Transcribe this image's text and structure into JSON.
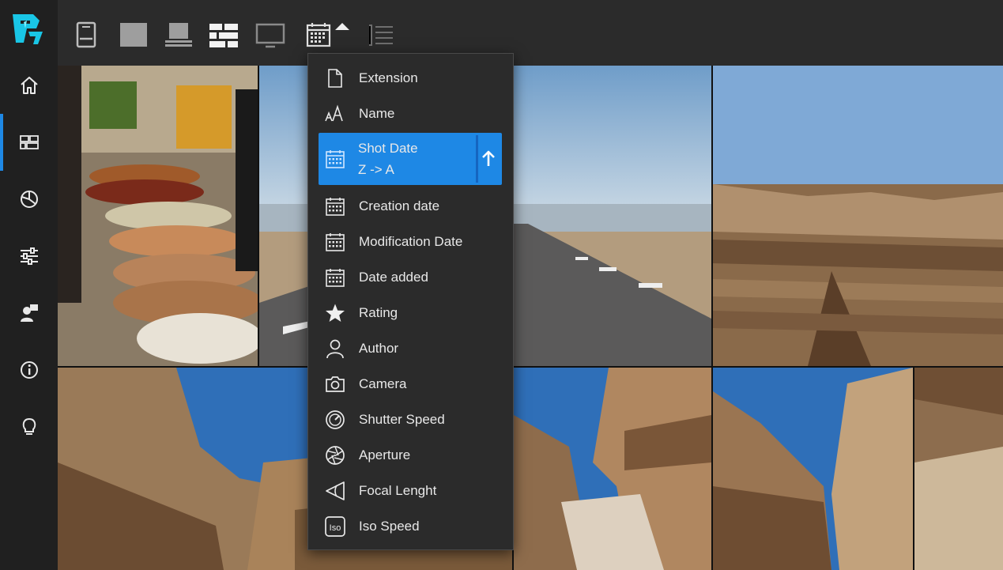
{
  "sidebar": {
    "items": [
      {
        "name": "home-icon",
        "active": false
      },
      {
        "name": "gallery-icon",
        "active": true
      },
      {
        "name": "chart-icon",
        "active": false
      },
      {
        "name": "settings-sliders-icon",
        "active": false
      },
      {
        "name": "people-icon",
        "active": false
      },
      {
        "name": "info-icon",
        "active": false
      },
      {
        "name": "lightbulb-icon",
        "active": false
      }
    ]
  },
  "toolbar": {
    "buttons": [
      "book-icon",
      "single-view-icon",
      "stack-view-icon",
      "grid-view-icon",
      "monitor-icon",
      "calendar-sort-icon",
      "list-icon"
    ]
  },
  "sort_menu": {
    "items": [
      {
        "label": "Extension",
        "icon": "file-icon"
      },
      {
        "label": "Name",
        "icon": "font-size-icon"
      },
      {
        "label": "Shot Date",
        "sublabel": "Z -> A",
        "icon": "calendar-icon",
        "selected": true,
        "direction": "ascending-arrow"
      },
      {
        "label": "Creation date",
        "icon": "calendar-icon"
      },
      {
        "label": "Modification Date",
        "icon": "calendar-icon"
      },
      {
        "label": "Date added",
        "icon": "calendar-icon"
      },
      {
        "label": "Rating",
        "icon": "star-icon"
      },
      {
        "label": "Author",
        "icon": "person-icon"
      },
      {
        "label": "Camera",
        "icon": "camera-icon"
      },
      {
        "label": "Shutter Speed",
        "icon": "gauge-icon"
      },
      {
        "label": "Aperture",
        "icon": "aperture-icon"
      },
      {
        "label": "Focal Lenght",
        "icon": "focal-icon"
      },
      {
        "label": "Iso Speed",
        "icon": "iso-icon"
      }
    ]
  },
  "colors": {
    "accent": "#1e88e5",
    "sidebar_bg": "#202020",
    "toolbar_bg": "#2b2b2b",
    "menu_bg": "#2b2b2b"
  }
}
